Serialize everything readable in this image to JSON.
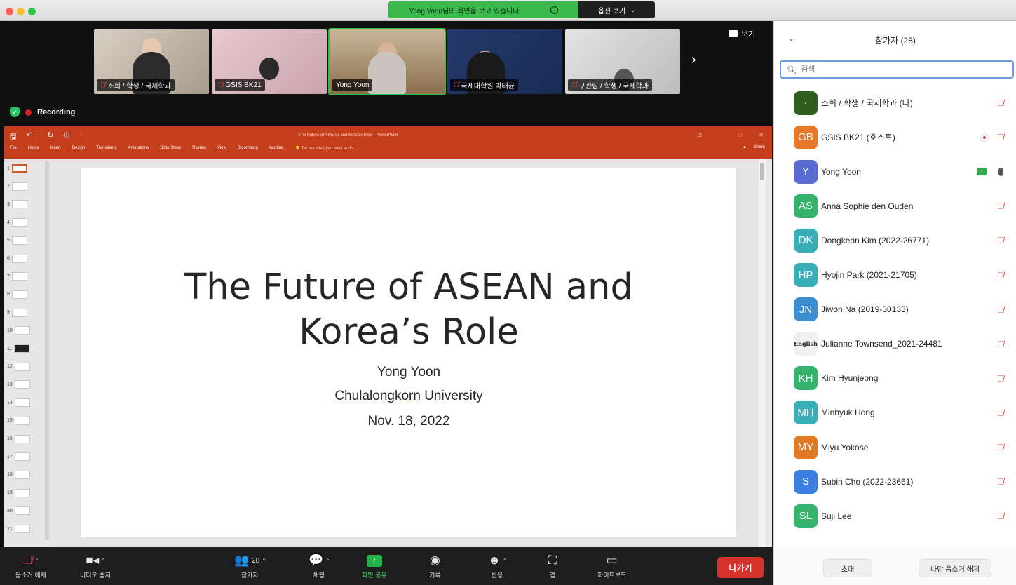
{
  "sharing_banner": {
    "text": "Yong Yoon님의 화면을 보고 있습니다",
    "view_options": "옵션 보기",
    "view_options_caret": "⌄"
  },
  "meeting": {
    "view_label": "보기",
    "recording_label": "Recording",
    "next_arrow": "›",
    "thumbnails": [
      {
        "name": "소희 / 학생 / 국제학과",
        "muted": true,
        "active": false
      },
      {
        "name": "GSIS BK21",
        "muted": true,
        "active": false
      },
      {
        "name": "Yong Yoon",
        "muted": false,
        "active": true
      },
      {
        "name": "국제대학원 박태균",
        "muted": true,
        "active": false
      },
      {
        "name": "구관림 / 학생 / 국제학과",
        "muted": true,
        "active": false
      }
    ]
  },
  "powerpoint": {
    "window_title": "The Future of ASEAN and Korea's Role - PowerPoint",
    "quick_access": [
      "🖫",
      "↶ ·",
      "↻",
      "⊞",
      "·"
    ],
    "window_controls": [
      "⊡",
      "–",
      "□",
      "✕"
    ],
    "ribbon_tabs": [
      "File",
      "Home",
      "Insert",
      "Design",
      "Transitions",
      "Animations",
      "Slide Show",
      "Review",
      "View",
      "Bloomberg",
      "Acrobat"
    ],
    "tell_me": "💡 Tell me what you want to do...",
    "share_label": "Share",
    "warning_glyph": "▲",
    "slide_count_visible": 21,
    "selected_slide": 1,
    "slide": {
      "title_line1": "The Future of ASEAN and",
      "title_line2": "Korea’s Role",
      "presenter": "Yong Yoon",
      "affiliation_underlined": "Chulalongkorn",
      "affiliation_rest": " University",
      "date": "Nov. 18, 2022"
    }
  },
  "toolbar": {
    "mute": "음소거 해제",
    "video": "비디오 중지",
    "participants": "참가자",
    "participants_count": "28",
    "chat": "채팅",
    "share": "화면 공유",
    "record": "기록",
    "reactions": "반응",
    "apps": "앱",
    "whiteboard": "화이트보드",
    "leave": "나가기"
  },
  "participants_panel": {
    "title": "참가자 (28)",
    "search_placeholder": "검색",
    "participants": [
      {
        "initials": "·",
        "name": "소희 / 학생 / 국제학과 (나)",
        "color": "#2f5e1e",
        "status": "muted"
      },
      {
        "initials": "GB",
        "name": "GSIS BK21 (호스트)",
        "color": "#e8792b",
        "status": "host-muted"
      },
      {
        "initials": "Y",
        "name": "Yong Yoon",
        "color": "#5a6bd1",
        "status": "sharing"
      },
      {
        "initials": "AS",
        "name": "Anna Sophie den Ouden",
        "color": "#35b36c",
        "status": "muted"
      },
      {
        "initials": "DK",
        "name": "Dongkeon Kim (2022-26771)",
        "color": "#3aaeb6",
        "status": "muted"
      },
      {
        "initials": "HP",
        "name": "Hyojin Park (2021-21705)",
        "color": "#3aaeb6",
        "status": "muted"
      },
      {
        "initials": "JN",
        "name": "Jiwon Na (2019-30133)",
        "color": "#3b8ed1",
        "status": "muted"
      },
      {
        "initials": "English",
        "name": "Julianne Townsend_2021-24481",
        "color": "#f0f0f0",
        "status": "muted"
      },
      {
        "initials": "KH",
        "name": "Kim Hyunjeong",
        "color": "#35b36c",
        "status": "muted"
      },
      {
        "initials": "MH",
        "name": "Minhyuk Hong",
        "color": "#3aaeb6",
        "status": "muted"
      },
      {
        "initials": "MY",
        "name": "Miyu Yokose",
        "color": "#e07b24",
        "status": "muted"
      },
      {
        "initials": "S",
        "name": "Subin Cho (2022-23661)",
        "color": "#3b7ee0",
        "status": "muted"
      },
      {
        "initials": "SL",
        "name": "Suji Lee",
        "color": "#35b36c",
        "status": "muted"
      }
    ],
    "invite": "초대",
    "unmute_me": "나만 음소거 해제"
  }
}
